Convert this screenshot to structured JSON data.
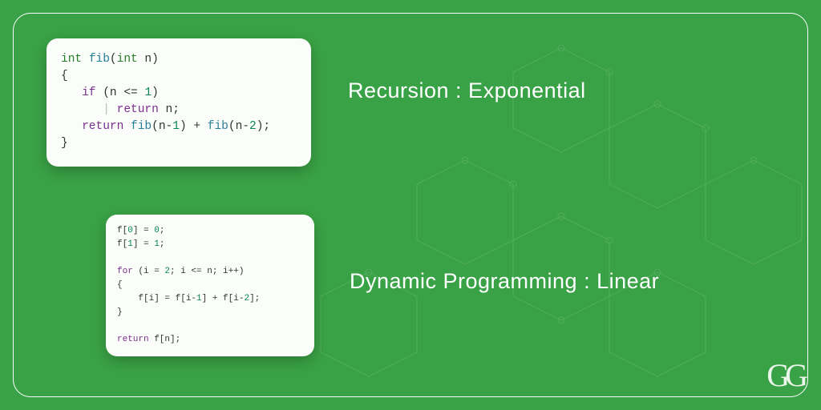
{
  "labels": {
    "recursion": "Recursion : Exponential",
    "dp": "Dynamic Programming : Linear"
  },
  "code": {
    "recursion": {
      "l1_kw1": "int",
      "l1_fn": "fib",
      "l1_paren_open": "(",
      "l1_kw2": "int",
      "l1_var": " n)",
      "l2": "{",
      "l3_indent": "   ",
      "l3_kw": "if",
      "l3_rest": " (n <= ",
      "l3_num": "1",
      "l3_close": ")",
      "l4_indent": "      ",
      "l4_fade": "| ",
      "l4_kw": "return",
      "l4_rest": " n;",
      "l5_indent": "   ",
      "l5_kw": "return",
      "l5_sp": " ",
      "l5_fn1": "fib",
      "l5_a": "(n-",
      "l5_n1": "1",
      "l5_b": ") + ",
      "l5_fn2": "fib",
      "l5_c": "(n-",
      "l5_n2": "2",
      "l5_d": ");",
      "l6": "}"
    },
    "dp": {
      "l1_a": "f[",
      "l1_n": "0",
      "l1_b": "] = ",
      "l1_v": "0",
      "l1_c": ";",
      "l2_a": "f[",
      "l2_n": "1",
      "l2_b": "] = ",
      "l2_v": "1",
      "l2_c": ";",
      "blank1": " ",
      "l3_kw": "for",
      "l3_a": " (i = ",
      "l3_n1": "2",
      "l3_b": "; i <= n; i++)",
      "l4": "{",
      "l5_indent": "    ",
      "l5_a": "f[i] = f[i-",
      "l5_n1": "1",
      "l5_b": "] + f[i-",
      "l5_n2": "2",
      "l5_c": "];",
      "l6": "}",
      "blank2": " ",
      "l7_kw": "return",
      "l7_a": " f[n];"
    }
  },
  "logo": "GG"
}
